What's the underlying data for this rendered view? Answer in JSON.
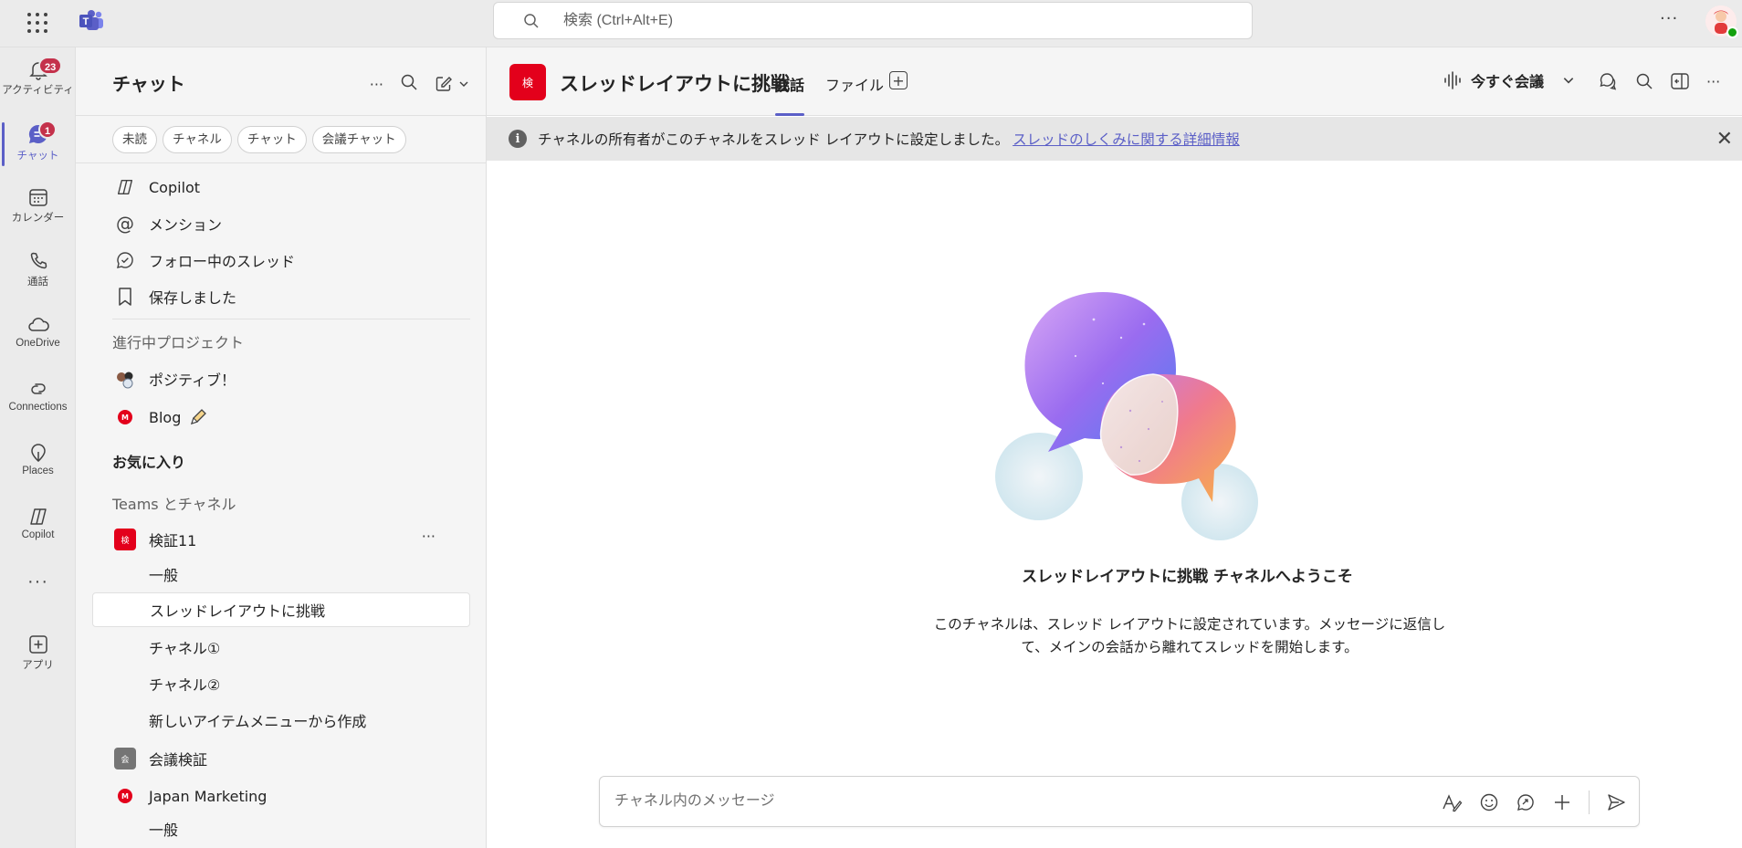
{
  "topbar": {
    "search_placeholder": "検索 (Ctrl+Alt+E)",
    "more_label": "···"
  },
  "rail": {
    "items": [
      {
        "label": "アクティビティ",
        "badge": "23"
      },
      {
        "label": "チャット",
        "badge": "1"
      },
      {
        "label": "カレンダー"
      },
      {
        "label": "通話"
      },
      {
        "label": "OneDrive"
      },
      {
        "label": "Connections"
      },
      {
        "label": "Places"
      },
      {
        "label": "Copilot"
      },
      {
        "label": "···"
      },
      {
        "label": "アプリ"
      }
    ]
  },
  "panel": {
    "title": "チャット",
    "more": "···",
    "chips": [
      "未読",
      "チャネル",
      "チャット",
      "会議チャット"
    ],
    "quick": [
      "Copilot",
      "メンション",
      "フォロー中のスレッド",
      "保存しました"
    ],
    "section_projects": "進行中プロジェクト",
    "projects": [
      {
        "name": "ポジティブ！"
      },
      {
        "name": "Blog",
        "badge": "M"
      }
    ],
    "section_favorites": "お気に入り",
    "section_teams": "Teams とチャネル",
    "teams": [
      {
        "name": "検証11",
        "icon": "検",
        "channels": [
          "一般",
          "スレッドレイアウトに挑戦",
          "チャネル①",
          "チャネル②",
          "新しいアイテムメニューから作成"
        ]
      },
      {
        "name": "会議検証",
        "icon": "会"
      },
      {
        "name": "Japan Marketing",
        "badge": "M",
        "channels": [
          "一般"
        ]
      }
    ]
  },
  "main": {
    "channel_icon": "検",
    "channel_title": "スレッドレイアウトに挑戦",
    "tabs": [
      "会話",
      "ファイル"
    ],
    "meet_now": "今すぐ会議",
    "banner_text": "チャネルの所有者がこのチャネルをスレッド レイアウトに設定しました。",
    "banner_link": "スレッドのしくみに関する詳細情報",
    "welcome_title": "スレッドレイアウトに挑戦 チャネルへようこそ",
    "welcome_line1": "このチャネルは、スレッド レイアウトに設定されています。メッセージに返信し",
    "welcome_line2": "て、メインの会話から離れてスレッドを開始します。",
    "compose_placeholder": "チャネル内のメッセージ"
  },
  "colors": {
    "accent": "#5b5fc7",
    "team_red": "#e3001b",
    "badge": "#c4314b"
  }
}
